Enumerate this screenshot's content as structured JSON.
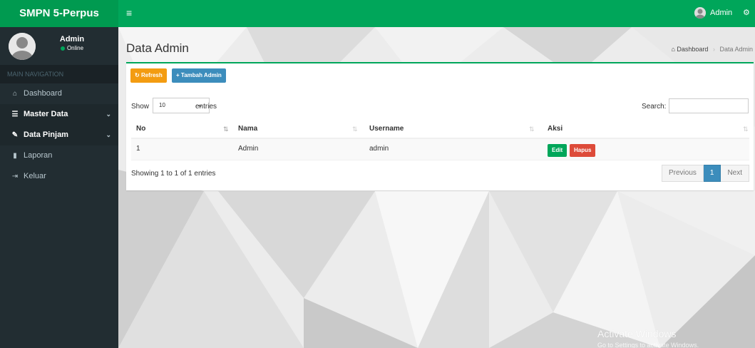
{
  "app": {
    "title_bold": "SMPN",
    "title_rest": " 5-Perpus"
  },
  "topbar": {
    "menu_icon": "≡",
    "user_name": "Admin",
    "gears_icon": "⚙"
  },
  "user_panel": {
    "name": "Admin",
    "status": "Online"
  },
  "sidebar": {
    "header": "MAIN NAVIGATION",
    "items": [
      {
        "label": "Dashboard",
        "icon": "home-icon"
      },
      {
        "label": "Master Data",
        "icon": "database-icon"
      },
      {
        "label": "Data Pinjam",
        "icon": "pencil-icon"
      },
      {
        "label": "Laporan",
        "icon": "file-icon"
      },
      {
        "label": "Keluar",
        "icon": "sign-out-icon"
      }
    ]
  },
  "page": {
    "title": "Data Admin",
    "breadcrumb": {
      "home": "Dashboard",
      "current": "Data Admin"
    }
  },
  "toolbar": {
    "refresh_label": "Refresh",
    "add_label": "Tambah Admin"
  },
  "datatable": {
    "show_label": "Show",
    "length_value": "10",
    "entries_label": "entries",
    "search_label": "Search:",
    "columns": [
      "No",
      "Nama",
      "Username",
      "Aksi"
    ],
    "rows": [
      {
        "no": "1",
        "nama": "Admin",
        "username": "admin"
      }
    ],
    "edit_label": "Edit",
    "delete_label": "Hapus",
    "info": "Showing 1 to 1 of 1 entries",
    "pagination": {
      "previous": "Previous",
      "current": "1",
      "next": "Next"
    }
  },
  "watermark": {
    "title": "Activate Windows",
    "subtitle": "Go to Settings to activate Windows."
  },
  "colors": {
    "brand_green": "#00a65a",
    "sidebar_dark": "#222d32",
    "primary_blue": "#3c8dbc",
    "warning_orange": "#f39c12",
    "danger_red": "#dd4b39"
  }
}
